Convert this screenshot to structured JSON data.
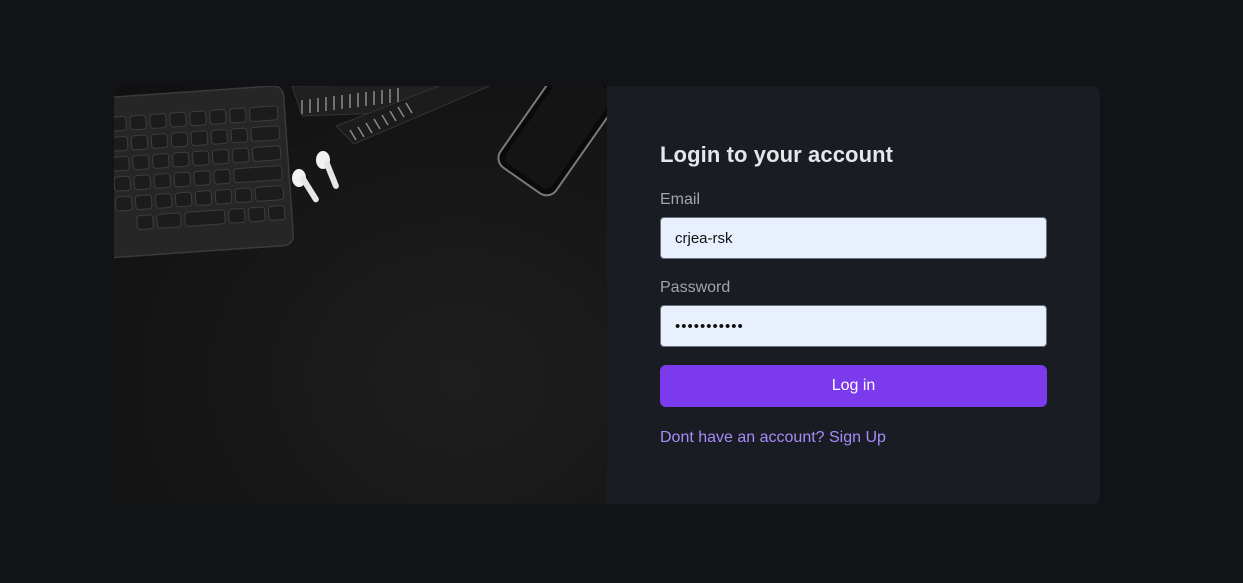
{
  "login": {
    "title": "Login to your account",
    "email_label": "Email",
    "email_value": "crjea-rsk",
    "password_label": "Password",
    "password_value": "...........",
    "submit_label": "Log in",
    "signup_link": "Dont have an account? Sign Up"
  },
  "colors": {
    "page_background": "#121317",
    "panel_background": "#1a1c23",
    "accent": "#7c3aed",
    "link": "#a78bfa",
    "input_background": "#e8f0fe"
  },
  "image": {
    "description_icons": [
      "keyboard-icon",
      "notebook-icon",
      "earbuds-icon",
      "smartphone-icon"
    ]
  }
}
